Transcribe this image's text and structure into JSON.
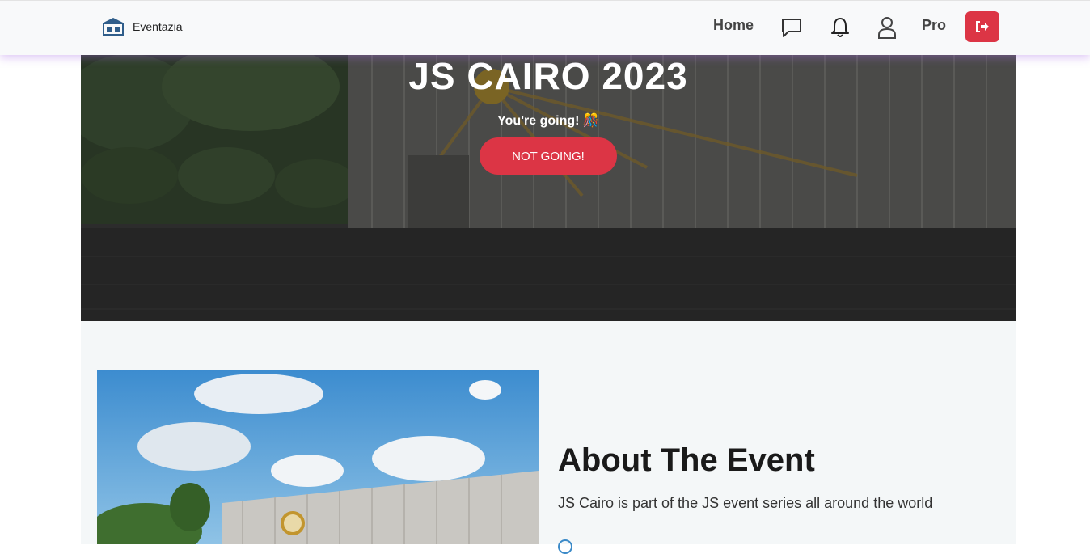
{
  "navbar": {
    "brand": "Eventazia",
    "home_label": "Home",
    "pro_label": "Pro",
    "icons": [
      "chat-icon",
      "bell-icon",
      "user-icon",
      "logout-icon"
    ]
  },
  "hero": {
    "title": "JS CAIRO 2023",
    "status": "You're going! 🎊",
    "button_label": "NOT GOING!"
  },
  "about": {
    "title": "About The Event",
    "description": "JS Cairo is part of the JS event series all around the world"
  },
  "colors": {
    "accent": "#dc3545",
    "navbar_bg": "#f8f9fa",
    "section_bg": "#f4f7f8"
  }
}
